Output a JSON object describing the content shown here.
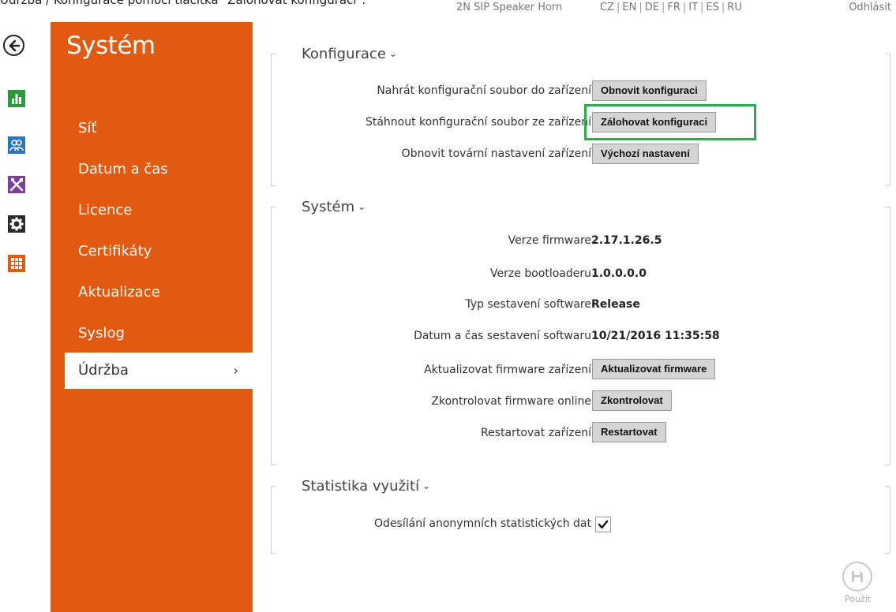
{
  "caption": "Údržba / Konfigurace pomocí tlačítka \"Zálohovat konfiguraci\".",
  "header": {
    "device_name": "2N SIP Speaker Horn",
    "languages": [
      "CZ",
      "EN",
      "DE",
      "FR",
      "IT",
      "ES",
      "RU"
    ],
    "logout": "Odhlásit"
  },
  "modules": [
    "back-icon",
    "status-icon",
    "users-icon",
    "services-icon",
    "hardware-icon",
    "system-icon"
  ],
  "sidebar": {
    "title": "Systém",
    "items": [
      {
        "label": "Síť"
      },
      {
        "label": "Datum a čas"
      },
      {
        "label": "Licence"
      },
      {
        "label": "Certifikáty"
      },
      {
        "label": "Aktualizace"
      },
      {
        "label": "Syslog"
      },
      {
        "label": "Údržba",
        "active": true
      }
    ],
    "active_chevron": "›"
  },
  "config": {
    "title": "Konfigurace",
    "upload_label": "Nahrát konfigurační soubor do zařízení",
    "upload_button": "Obnovit konfiguraci",
    "download_label": "Stáhnout konfigurační soubor ze zařízení",
    "download_button": "Zálohovat konfiguraci",
    "reset_label": "Obnovit tovární nastavení zařízení",
    "reset_button": "Výchozí nastavení"
  },
  "system": {
    "title": "Systém",
    "firmware_label": "Verze firmware",
    "firmware_value": "2.17.1.26.5",
    "bootloader_label": "Verze bootloaderu",
    "bootloader_value": "1.0.0.0.0",
    "build_type_label": "Typ sestavení software",
    "build_type_value": "Release",
    "build_date_label": "Datum a čas sestavení softwaru",
    "build_date_value": "10/21/2016 11:35:58",
    "update_label": "Aktualizovat firmware zařízení",
    "update_button": "Aktualizovat firmware",
    "check_label": "Zkontrolovat firmware online",
    "check_button": "Zkontrolovat",
    "restart_label": "Restartovat zařízení",
    "restart_button": "Restartovat"
  },
  "stats": {
    "title": "Statistika využití",
    "anon_label": "Odesílání anonymních statistických dat",
    "anon_checked": true
  },
  "save": {
    "label": "Použít"
  },
  "colors": {
    "accent": "#e25a0f",
    "highlight": "#2fa94a"
  }
}
